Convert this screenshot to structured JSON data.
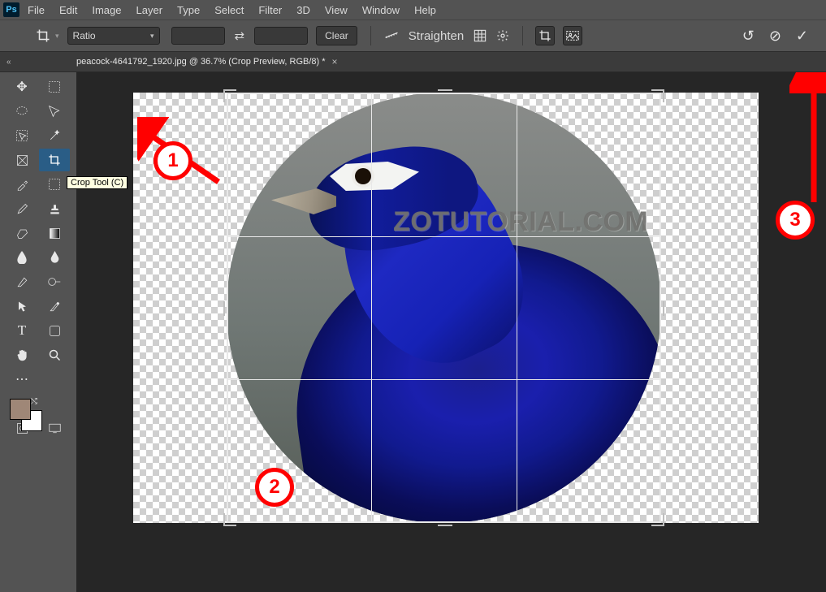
{
  "app_logo": "Ps",
  "menu": [
    "File",
    "Edit",
    "Image",
    "Layer",
    "Type",
    "Select",
    "Filter",
    "3D",
    "View",
    "Window",
    "Help"
  ],
  "options_bar": {
    "ratio_label": "Ratio",
    "clear_label": "Clear",
    "straighten_label": "Straighten"
  },
  "tab": {
    "title": "peacock-4641792_1920.jpg @ 36.7% (Crop Preview, RGB/8) *"
  },
  "tooltip": "Crop Tool (C)",
  "watermark": "ZOTUTORIAL.COM",
  "annotations": {
    "one": "1",
    "two": "2",
    "three": "3"
  },
  "swatches": {
    "fg": "#9f8777",
    "bg": "#ffffff"
  }
}
